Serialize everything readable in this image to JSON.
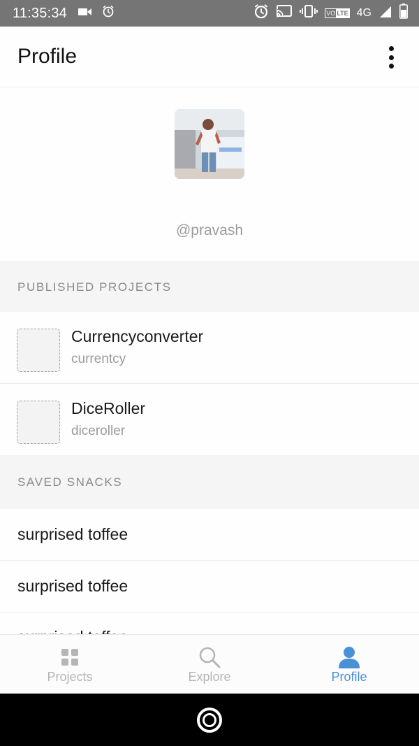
{
  "status_bar": {
    "time": "11:35:34",
    "network": "4G",
    "volte_label": "VO",
    "lte_label": "LTE"
  },
  "app_bar": {
    "title": "Profile"
  },
  "profile": {
    "username": "@pravash"
  },
  "published_projects": {
    "header": "PUBLISHED PROJECTS",
    "items": [
      {
        "name": "Currencyconverter",
        "slug": "currentcy"
      },
      {
        "name": "DiceRoller",
        "slug": "diceroller"
      }
    ]
  },
  "saved_snacks": {
    "header": "SAVED SNACKS",
    "items": [
      {
        "name": "surprised toffee"
      },
      {
        "name": "surprised toffee"
      },
      {
        "name": "surprised toffee"
      }
    ]
  },
  "tabs": [
    {
      "label": "Projects",
      "icon": "grid-icon",
      "active": false
    },
    {
      "label": "Explore",
      "icon": "search-icon",
      "active": false
    },
    {
      "label": "Profile",
      "icon": "person-icon",
      "active": true
    }
  ],
  "colors": {
    "accent": "#4a90d6",
    "status_bar": "#757575",
    "section_bg": "#f5f5f5"
  }
}
